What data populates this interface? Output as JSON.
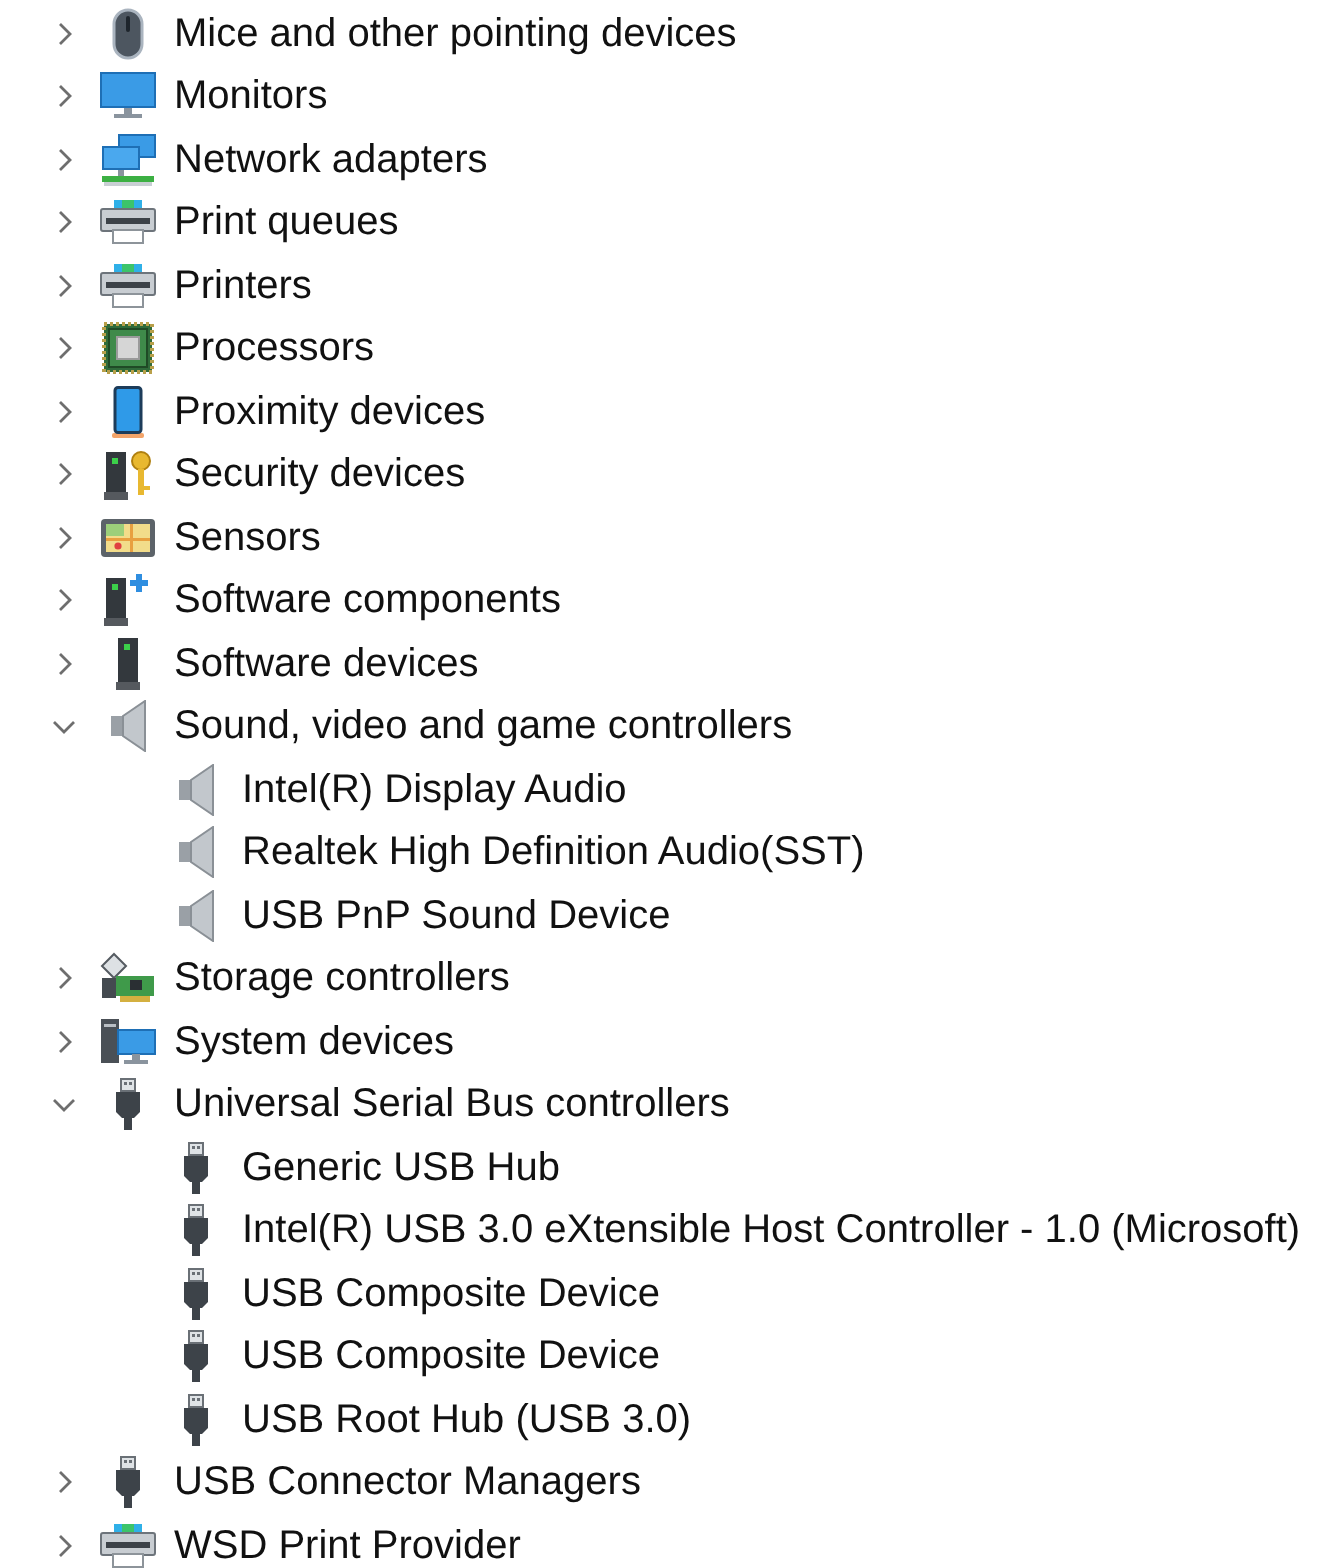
{
  "tree": {
    "items": [
      {
        "label": "Mice and other pointing devices",
        "kind": "mouse",
        "expanded": false
      },
      {
        "label": "Monitors",
        "kind": "monitor",
        "expanded": false
      },
      {
        "label": "Network adapters",
        "kind": "network",
        "expanded": false
      },
      {
        "label": "Print queues",
        "kind": "printer",
        "expanded": false
      },
      {
        "label": "Printers",
        "kind": "printer",
        "expanded": false
      },
      {
        "label": "Processors",
        "kind": "processor",
        "expanded": false
      },
      {
        "label": "Proximity devices",
        "kind": "phone",
        "expanded": false
      },
      {
        "label": "Security devices",
        "kind": "security",
        "expanded": false
      },
      {
        "label": "Sensors",
        "kind": "sensor",
        "expanded": false
      },
      {
        "label": "Software components",
        "kind": "component",
        "expanded": false
      },
      {
        "label": "Software devices",
        "kind": "tower",
        "expanded": false
      },
      {
        "label": "Sound, video and game controllers",
        "kind": "speaker",
        "expanded": true,
        "children": [
          {
            "label": "Intel(R) Display Audio",
            "kind": "speaker"
          },
          {
            "label": "Realtek High Definition Audio(SST)",
            "kind": "speaker"
          },
          {
            "label": "USB PnP Sound Device",
            "kind": "speaker"
          }
        ]
      },
      {
        "label": "Storage controllers",
        "kind": "storage",
        "expanded": false
      },
      {
        "label": "System devices",
        "kind": "system",
        "expanded": false
      },
      {
        "label": "Universal Serial Bus controllers",
        "kind": "usb",
        "expanded": true,
        "children": [
          {
            "label": "Generic USB Hub",
            "kind": "usb"
          },
          {
            "label": "Intel(R) USB 3.0 eXtensible Host Controller - 1.0 (Microsoft)",
            "kind": "usb"
          },
          {
            "label": "USB Composite Device",
            "kind": "usb"
          },
          {
            "label": "USB Composite Device",
            "kind": "usb"
          },
          {
            "label": "USB Root Hub (USB 3.0)",
            "kind": "usb"
          }
        ]
      },
      {
        "label": "USB Connector Managers",
        "kind": "usb",
        "expanded": false
      },
      {
        "label": "WSD Print Provider",
        "kind": "printer",
        "expanded": false
      }
    ]
  }
}
